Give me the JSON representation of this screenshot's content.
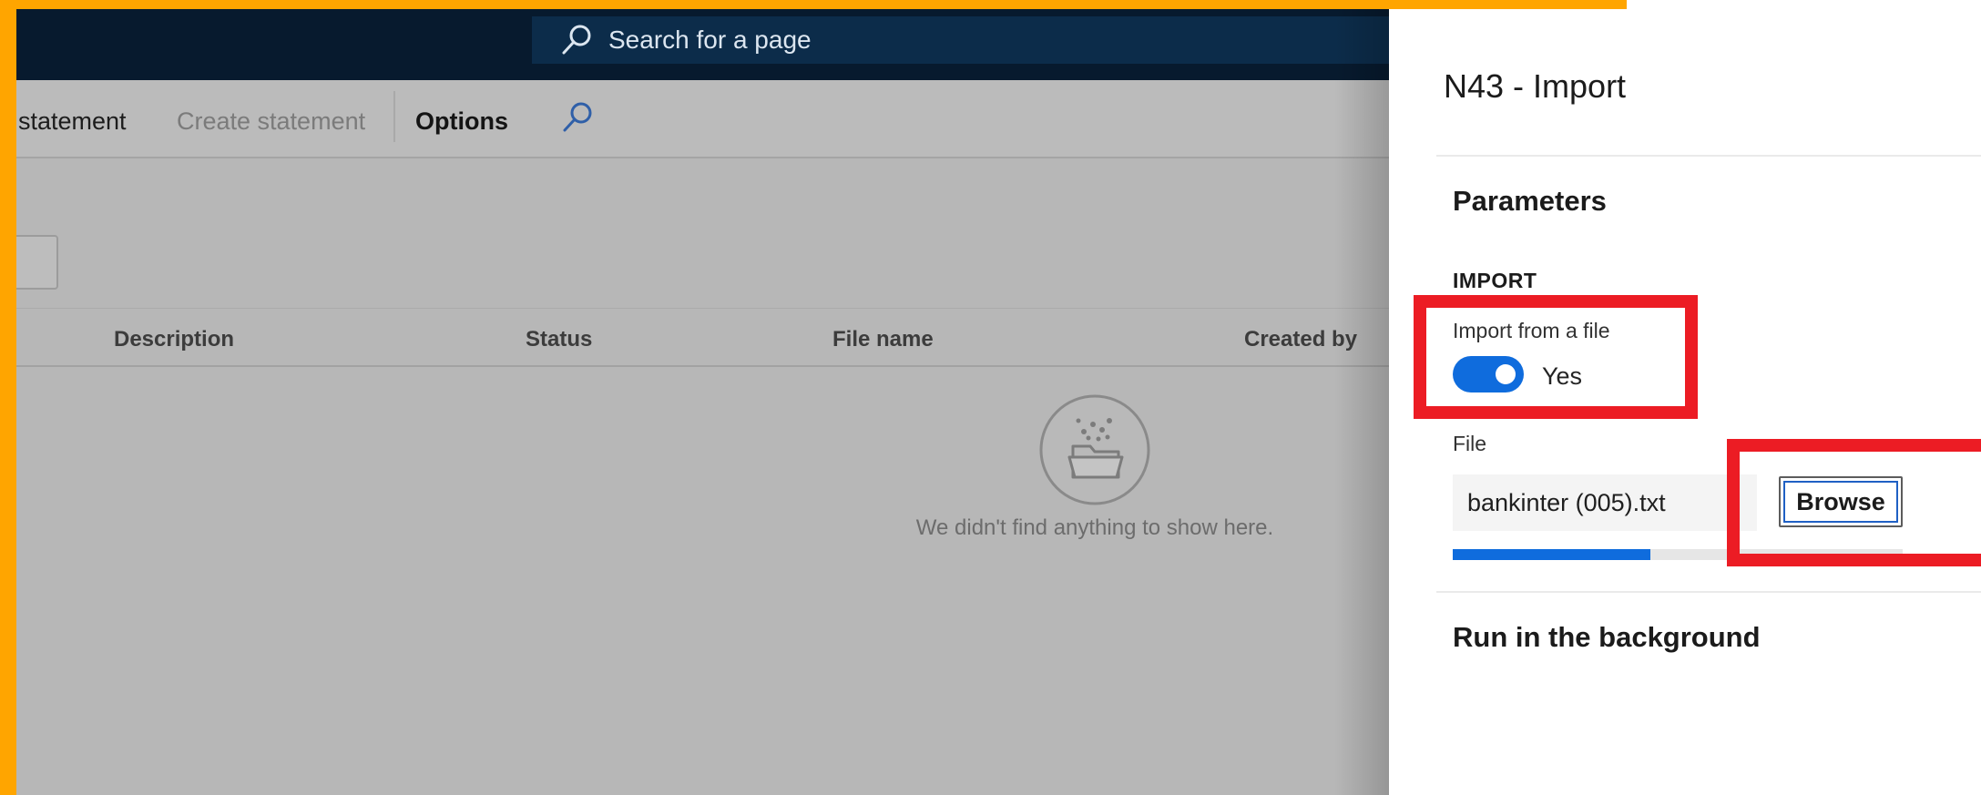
{
  "search": {
    "placeholder": "Search for a page"
  },
  "toolbar": {
    "statement_label": "statement",
    "create_statement_label": "Create statement",
    "options_label": "Options"
  },
  "grid": {
    "columns": [
      "Description",
      "Status",
      "File name",
      "Created by"
    ],
    "empty_message": "We didn't find anything to show here."
  },
  "panel": {
    "title": "N43 - Import",
    "parameters_title": "Parameters",
    "import_group_label": "IMPORT",
    "import_from_file_label": "Import from a file",
    "import_from_file_value": "Yes",
    "file_label": "File",
    "file_value": "bankinter (005).txt",
    "browse_label": "Browse",
    "upload_progress": 0.44,
    "run_in_background_title": "Run in the background"
  },
  "colors": {
    "accent": "#0f6cdd",
    "app_bar": "#071a2e",
    "annotation_red": "#ec1c24",
    "annotation_orange": "#ffa500"
  },
  "icons": {
    "search": "search-icon",
    "find": "find-icon",
    "empty": "empty-folder-icon"
  }
}
